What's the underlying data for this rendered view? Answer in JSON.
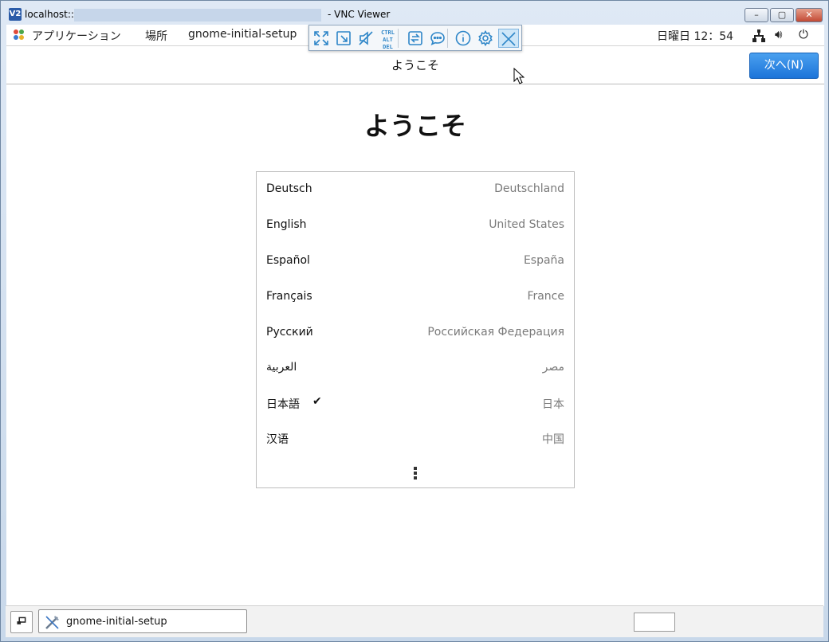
{
  "window": {
    "host": "localhost::",
    "app_title": "- VNC Viewer",
    "app_icon": "V2",
    "buttons": {
      "minimize": "–",
      "maximize": "▢",
      "close": "✕"
    }
  },
  "gnome_bar": {
    "applications": "アプリケーション",
    "places": "場所",
    "app_name": "gnome-initial-setup",
    "clock": "日曜日 12：54",
    "icons": [
      "network-icon",
      "volume-icon",
      "power-icon"
    ]
  },
  "vnc_toolbar": {
    "icons": [
      "fullscreen-icon",
      "scale-icon",
      "mute-icon",
      "ctrl-alt-del-icon",
      "transfer-icon",
      "chat-icon",
      "info-icon",
      "settings-icon",
      "close-icon"
    ],
    "ctrl_alt_del": [
      "CTRL",
      "ALT",
      "DEL"
    ]
  },
  "header": {
    "title": "ようこそ",
    "next_button": "次へ(N)"
  },
  "main": {
    "title": "ようこそ",
    "languages": [
      {
        "name": "Deutsch",
        "country": "Deutschland",
        "selected": false
      },
      {
        "name": "English",
        "country": "United States",
        "selected": false
      },
      {
        "name": "Español",
        "country": "España",
        "selected": false
      },
      {
        "name": "Français",
        "country": "France",
        "selected": false
      },
      {
        "name": "Русский",
        "country": "Российская Федерация",
        "selected": false
      },
      {
        "name": "العربية",
        "country": "مصر",
        "selected": false
      },
      {
        "name": "日本語",
        "country": "日本",
        "selected": true
      },
      {
        "name": "汉语",
        "country": "中国",
        "selected": false
      }
    ],
    "check_mark": "✔"
  },
  "taskbar": {
    "task_label": "gnome-initial-setup"
  },
  "colors": {
    "accent": "#2e86c8",
    "primary_button": "#1c74d9"
  }
}
